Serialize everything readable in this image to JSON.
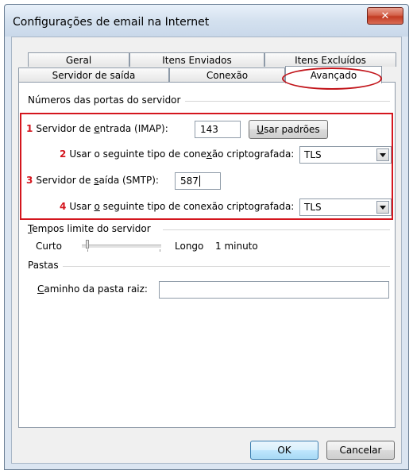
{
  "window": {
    "title": "Configurações de email na Internet",
    "close_symbol": "✕"
  },
  "tabs": {
    "row1": [
      "Geral",
      "Itens Enviados",
      "Itens Excluídos"
    ],
    "row2": [
      "Servidor de saída",
      "Conexão",
      "Avançado"
    ],
    "active": "Avançado"
  },
  "ports": {
    "section_title": "Números das portas do servidor",
    "incoming": {
      "number": "1",
      "label_pre": "Servidor de ",
      "label_ul": "e",
      "label_post": "ntrada (IMAP):",
      "value": "143"
    },
    "use_defaults_button": {
      "ul": "U",
      "rest": "sar padrões"
    },
    "incoming_encryption": {
      "number": "2",
      "label_pre": "Usar o seguinte tipo de cone",
      "label_ul": "x",
      "label_post": "ão criptografada:",
      "value": "TLS"
    },
    "outgoing": {
      "number": "3",
      "label_pre": "Servidor de ",
      "label_ul": "s",
      "label_post": "aída (SMTP):",
      "value": "587"
    },
    "outgoing_encryption": {
      "number": "4",
      "label_pre": "Usar ",
      "label_ul": "o",
      "label_post": " seguinte tipo de conexão criptografada:",
      "value": "TLS"
    }
  },
  "timeouts": {
    "section_ul": "T",
    "section_rest": "empos limite do servidor",
    "short_label": "Curto",
    "long_label": "Longo",
    "value": "1 minuto"
  },
  "folders": {
    "section_title": "Pastas",
    "root_path_ul": "C",
    "root_path_rest": "aminho da pasta raiz:",
    "root_path_value": ""
  },
  "buttons": {
    "ok": "OK",
    "cancel": "Cancelar"
  },
  "colors": {
    "annotation_red": "#d4161e",
    "close_button": "#c23a22"
  }
}
